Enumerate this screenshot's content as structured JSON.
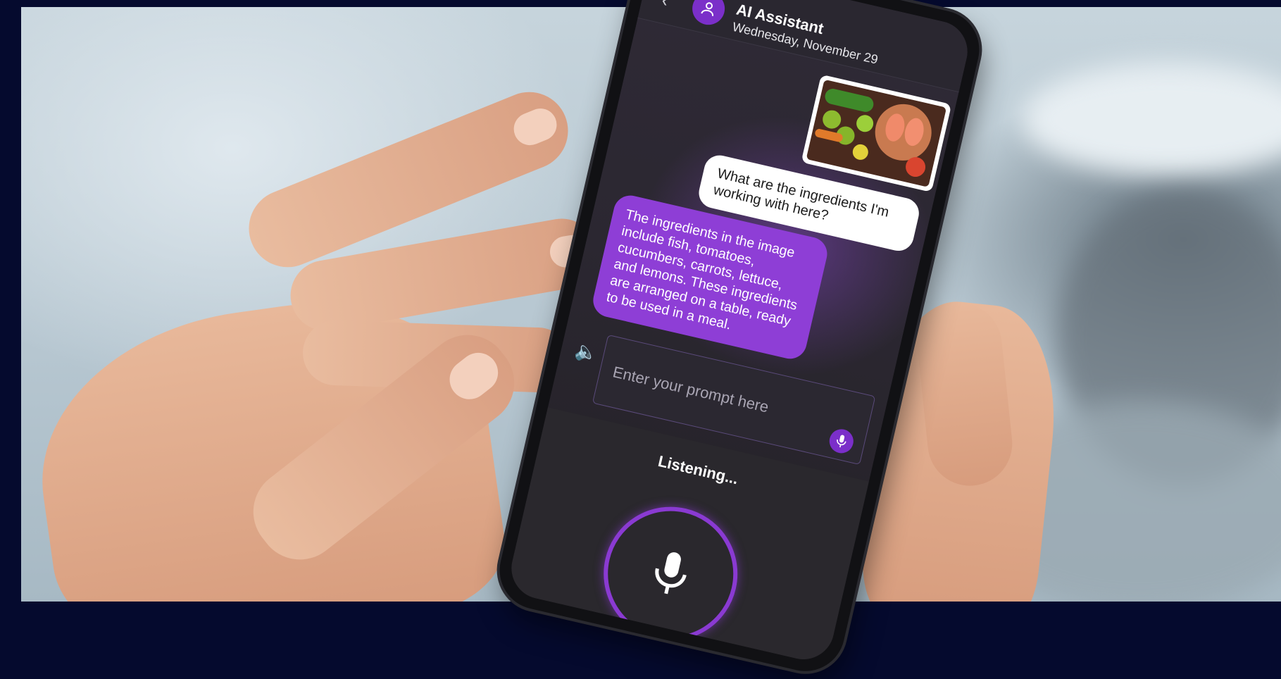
{
  "app": {
    "title": "AI Assistant",
    "date": "Wednesday, November 29"
  },
  "messages": {
    "user_question": "What are the ingredients I'm working with here?",
    "assistant_reply": "The ingredients in the image include fish, tomatoes, cucumbers, carrots, lettuce, and lemons. These ingredients are arranged on a table, ready to be used in a meal."
  },
  "input": {
    "placeholder": "Enter your prompt here"
  },
  "voice": {
    "status": "Listening..."
  },
  "icons": {
    "back": "back-arrow-icon",
    "avatar": "user-icon",
    "speaker": "speaker-icon",
    "input_mic": "microphone-icon",
    "big_mic": "microphone-icon"
  },
  "colors": {
    "accent": "#8e3ed6",
    "frame": "#050a2e"
  }
}
